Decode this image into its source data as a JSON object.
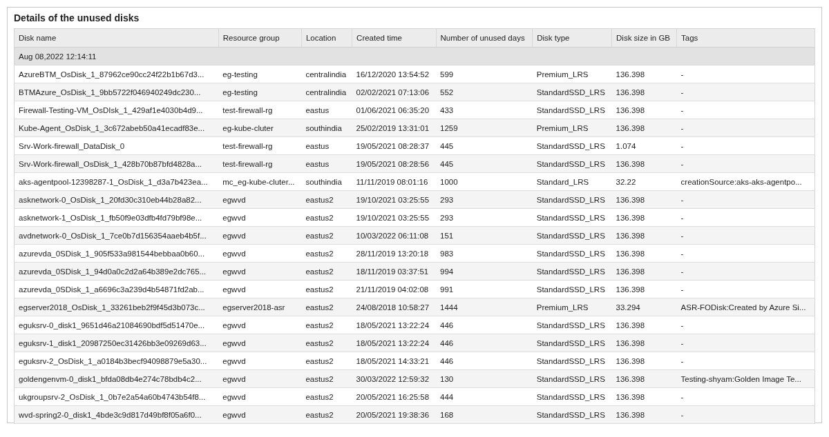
{
  "panel": {
    "title": "Details of the unused disks"
  },
  "table": {
    "columns": [
      "Disk name",
      "Resource group",
      "Location",
      "Created time",
      "Number of unused days",
      "Disk type",
      "Disk size in GB",
      "Tags"
    ],
    "groups": [
      {
        "label": "Aug 08,2022 12:14:11",
        "rows": [
          [
            "AzureBTM_OsDisk_1_87962ce90cc24f22b1b67d3...",
            "eg-testing",
            "centralindia",
            "16/12/2020 13:54:52",
            "599",
            "Premium_LRS",
            "136.398",
            "-"
          ],
          [
            "BTMAzure_OsDisk_1_9bb5722f046940249dc230...",
            "eg-testing",
            "centralindia",
            "02/02/2021 07:13:06",
            "552",
            "StandardSSD_LRS",
            "136.398",
            "-"
          ],
          [
            "Firewall-Testing-VM_OsDIsk_1_429af1e4030b4d9...",
            "test-firewall-rg",
            "eastus",
            "01/06/2021 06:35:20",
            "433",
            "StandardSSD_LRS",
            "136.398",
            "-"
          ],
          [
            "Kube-Agent_OsDisk_1_3c672abeb50a41ecadf83e...",
            "eg-kube-cluter",
            "southindia",
            "25/02/2019 13:31:01",
            "1259",
            "Premium_LRS",
            "136.398",
            "-"
          ],
          [
            "Srv-Work-firewall_DataDisk_0",
            "test-firewall-rg",
            "eastus",
            "19/05/2021 08:28:37",
            "445",
            "StandardSSD_LRS",
            "1.074",
            "-"
          ],
          [
            "Srv-Work-firewall_OsDisk_1_428b70b87bfd4828a...",
            "test-firewall-rg",
            "eastus",
            "19/05/2021 08:28:56",
            "445",
            "StandardSSD_LRS",
            "136.398",
            "-"
          ],
          [
            "aks-agentpool-12398287-1_OsDisk_1_d3a7b423ea...",
            "mc_eg-kube-cluter...",
            "southindia",
            "11/11/2019 08:01:16",
            "1000",
            "Standard_LRS",
            "32.22",
            "creationSource:aks-aks-agentpo..."
          ],
          [
            "asknetwork-0_OsDisk_1_20fd30c310eb44b28a82...",
            "egwvd",
            "eastus2",
            "19/10/2021 03:25:55",
            "293",
            "StandardSSD_LRS",
            "136.398",
            "-"
          ],
          [
            "asknetwork-1_OsDisk_1_fb50f9e03dfb4fd79bf98e...",
            "egwvd",
            "eastus2",
            "19/10/2021 03:25:55",
            "293",
            "StandardSSD_LRS",
            "136.398",
            "-"
          ],
          [
            "avdnetwork-0_OsDisk_1_7ce0b7d156354aaeb4b5f...",
            "egwvd",
            "eastus2",
            "10/03/2022 06:11:08",
            "151",
            "StandardSSD_LRS",
            "136.398",
            "-"
          ],
          [
            "azurevda_0SDisk_1_905f533a981544bebbaa0b60...",
            "egwvd",
            "eastus2",
            "28/11/2019 13:20:18",
            "983",
            "StandardSSD_LRS",
            "136.398",
            "-"
          ],
          [
            "azurevda_0SDisk_1_94d0a0c2d2a64b389e2dc765...",
            "egwvd",
            "eastus2",
            "18/11/2019 03:37:51",
            "994",
            "StandardSSD_LRS",
            "136.398",
            "-"
          ],
          [
            "azurevda_0SDisk_1_a6696c3a239d4b54871fd2ab...",
            "egwvd",
            "eastus2",
            "21/11/2019 04:02:08",
            "991",
            "StandardSSD_LRS",
            "136.398",
            "-"
          ],
          [
            "egserver2018_OsDisk_1_33261beb2f9f45d3b073c...",
            "egserver2018-asr",
            "eastus2",
            "24/08/2018 10:58:27",
            "1444",
            "Premium_LRS",
            "33.294",
            "ASR-FODisk:Created by Azure Si..."
          ],
          [
            "eguksrv-0_disk1_9651d46a21084690bdf5d51470e...",
            "egwvd",
            "eastus2",
            "18/05/2021 13:22:24",
            "446",
            "StandardSSD_LRS",
            "136.398",
            "-"
          ],
          [
            "eguksrv-1_disk1_20987250ec31426bb3e09269d63...",
            "egwvd",
            "eastus2",
            "18/05/2021 13:22:24",
            "446",
            "StandardSSD_LRS",
            "136.398",
            "-"
          ],
          [
            "eguksrv-2_OsDisk_1_a0184b3becf94098879e5a30...",
            "egwvd",
            "eastus2",
            "18/05/2021 14:33:21",
            "446",
            "StandardSSD_LRS",
            "136.398",
            "-"
          ],
          [
            "goldengenvm-0_disk1_bfda08db4e274c78bdb4c2...",
            "egwvd",
            "eastus2",
            "30/03/2022 12:59:32",
            "130",
            "StandardSSD_LRS",
            "136.398",
            "Testing-shyam:Golden Image Te..."
          ],
          [
            "ukgroupsrv-2_OsDisk_1_0b7e2a54a60b4743b54f8...",
            "egwvd",
            "eastus2",
            "20/05/2021 16:25:58",
            "444",
            "StandardSSD_LRS",
            "136.398",
            "-"
          ],
          [
            "wvd-spring2-0_disk1_4bde3c9d817d49bf8f05a6f0...",
            "egwvd",
            "eastus2",
            "20/05/2021 19:38:36",
            "168",
            "StandardSSD_LRS",
            "136.398",
            "-"
          ]
        ]
      }
    ]
  }
}
